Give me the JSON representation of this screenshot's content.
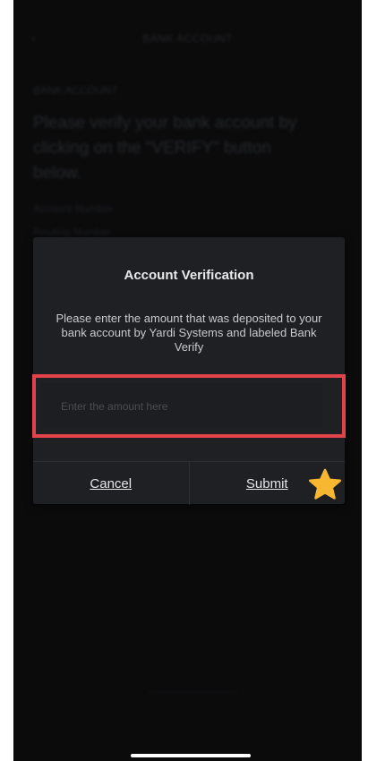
{
  "background_screen": {
    "nav_back_glyph": "‹",
    "nav_title": "BANK ACCOUNT",
    "section_label": "BANK ACCOUNT",
    "heading": "Please verify your bank account by clicking on the \"VERIFY\" button below.",
    "line_1": "Account Number",
    "line_2": "Routing Number"
  },
  "dialog": {
    "title": "Account Verification",
    "message": "Please enter the amount that was deposited to your bank account by Yardi Systems and labeled Bank Verify",
    "amount_input": {
      "placeholder": "Enter the amount here",
      "value": ""
    },
    "cancel_label": "Cancel",
    "submit_label": "Submit"
  },
  "annotations": {
    "highlight_color": "#e2434b",
    "star_color": "#f7b731"
  },
  "icons": [
    "chevron-left-icon",
    "star-icon"
  ]
}
